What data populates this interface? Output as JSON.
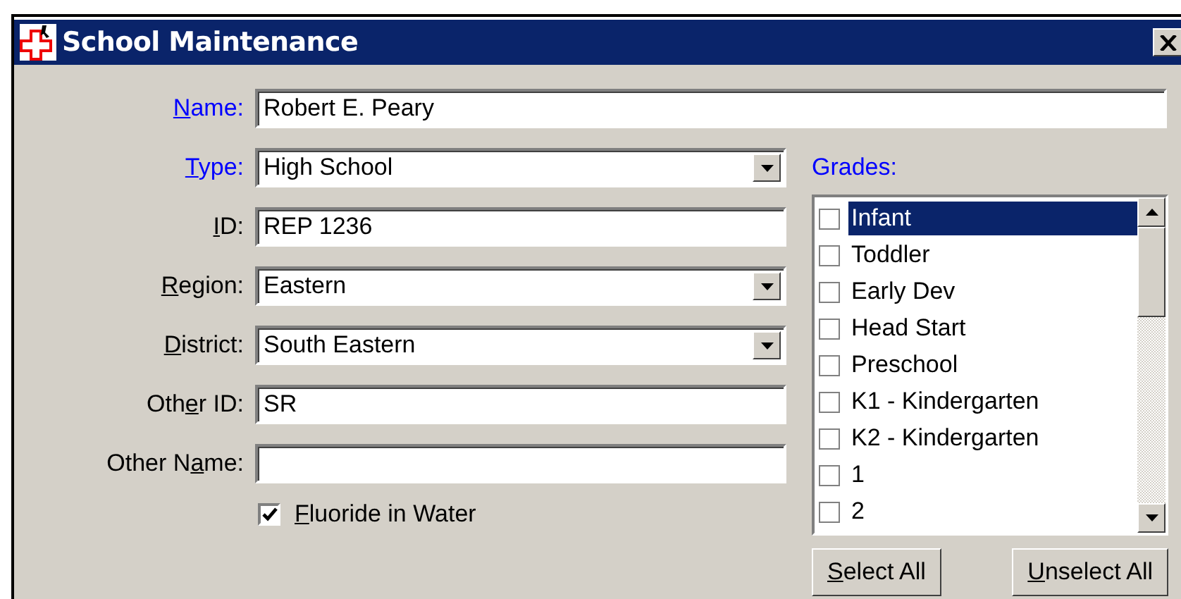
{
  "window": {
    "title": "School Maintenance"
  },
  "fields": [
    {
      "kind": "text",
      "label": {
        "key": "N",
        "after": "ame:"
      },
      "required": true,
      "value": "Robert E. Peary",
      "wide": true
    },
    {
      "kind": "dropdown",
      "label": {
        "key": "T",
        "after": "ype:"
      },
      "required": true,
      "value": "High School",
      "wide": false
    },
    {
      "kind": "text",
      "label": {
        "key": "I",
        "after": "D:"
      },
      "required": false,
      "value": "REP 1236",
      "wide": false
    },
    {
      "kind": "dropdown",
      "label": {
        "key": "R",
        "after": "egion:"
      },
      "required": false,
      "value": "Eastern",
      "wide": false
    },
    {
      "kind": "dropdown",
      "label": {
        "key": "D",
        "after": "istrict:"
      },
      "required": false,
      "value": "South Eastern",
      "wide": false
    },
    {
      "kind": "text",
      "label": {
        "before": "Oth",
        "key": "e",
        "after": "r ID:"
      },
      "required": false,
      "value": "SR",
      "wide": false
    },
    {
      "kind": "text",
      "label": {
        "before": "Other N",
        "key": "a",
        "after": "me:"
      },
      "required": false,
      "wide": false
    }
  ],
  "fluoride": {
    "label": {
      "key": "F",
      "after": "luoride in Water"
    },
    "checked": true
  },
  "grades": {
    "label": "Grades:",
    "items": [
      {
        "label": "Infant",
        "checked": false,
        "selected": true
      },
      {
        "label": "Toddler",
        "checked": false,
        "selected": false
      },
      {
        "label": "Early Dev",
        "checked": false,
        "selected": false
      },
      {
        "label": "Head Start",
        "checked": false,
        "selected": false
      },
      {
        "label": "Preschool",
        "checked": false,
        "selected": false
      },
      {
        "label": "K1 -  Kindergarten",
        "checked": false,
        "selected": false
      },
      {
        "label": "K2 -  Kindergarten",
        "checked": false,
        "selected": false
      },
      {
        "label": "1",
        "checked": false,
        "selected": false
      },
      {
        "label": "2",
        "checked": false,
        "selected": false
      }
    ]
  },
  "buttons": [
    {
      "label": {
        "key": "S",
        "after": "elect All"
      }
    },
    {
      "label": {
        "key": "U",
        "after": "nselect All"
      }
    }
  ]
}
